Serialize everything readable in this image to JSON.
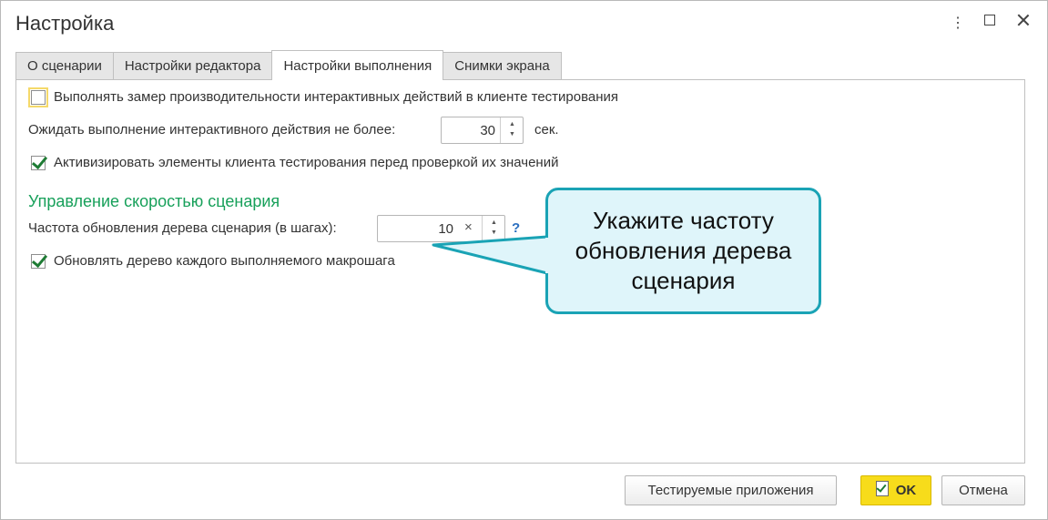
{
  "window": {
    "title": "Настройка",
    "controls": {
      "more_icon": "⋮"
    }
  },
  "tabs": [
    {
      "label": "О сценарии",
      "active": false
    },
    {
      "label": "Настройки редактора",
      "active": false
    },
    {
      "label": "Настройки выполнения",
      "active": true
    },
    {
      "label": "Снимки экрана",
      "active": false
    }
  ],
  "settings": {
    "measure_perf": {
      "label": "Выполнять замер производительности интерактивных действий в клиенте тестирования",
      "checked": false
    },
    "wait": {
      "label": "Ожидать выполнение интерактивного действия не более:",
      "value": "30",
      "unit": "сек."
    },
    "activate": {
      "label": "Активизировать элементы клиента тестирования перед проверкой их значений",
      "checked": true
    }
  },
  "speed": {
    "section_title": "Управление скоростью сценария",
    "freq": {
      "label": "Частота обновления дерева сценария (в шагах):",
      "value": "10",
      "clear": "×",
      "help": "?"
    },
    "update_tree": {
      "label": "Обновлять дерево каждого выполняемого макрошага",
      "checked": true
    }
  },
  "callout": {
    "text": "Укажите частоту обновления дерева сценария"
  },
  "footer": {
    "tested_apps_label": "Тестируемые приложения",
    "ok_label": "OK",
    "cancel_label": "Отмена"
  },
  "colors": {
    "section": "#17a05a",
    "callout_border": "#1aa3b5",
    "callout_bg": "#dff5fa",
    "ok_button": "#f7dc1b"
  }
}
